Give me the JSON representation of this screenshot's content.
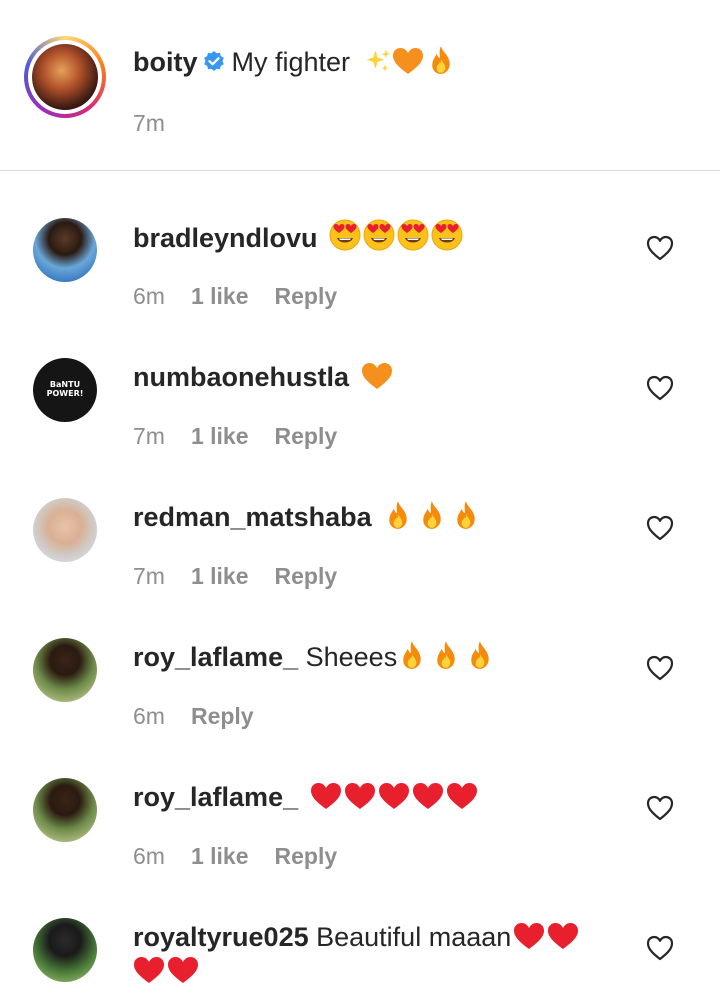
{
  "caption": {
    "username": "boity",
    "text": "My fighter",
    "emojis": [
      "sparkles",
      "orange-heart",
      "fire"
    ],
    "time": "7m"
  },
  "comments": [
    {
      "username": "bradleyndlovu",
      "text": "",
      "emojis": [
        "heart-eyes",
        "heart-eyes",
        "heart-eyes",
        "heart-eyes"
      ],
      "time": "6m",
      "likes": "1 like",
      "reply": "Reply"
    },
    {
      "username": "numbaonehustla",
      "avatar_text": "BaNTU POWER!",
      "text": "",
      "emojis": [
        "orange-heart"
      ],
      "time": "7m",
      "likes": "1 like",
      "reply": "Reply"
    },
    {
      "username": "redman_matshaba",
      "text": "",
      "emojis": [
        "fire",
        "fire",
        "fire"
      ],
      "time": "7m",
      "likes": "1 like",
      "reply": "Reply"
    },
    {
      "username": "roy_laflame_",
      "text": "Sheees",
      "emojis": [
        "fire",
        "fire",
        "fire"
      ],
      "time": "6m",
      "likes": "",
      "reply": "Reply"
    },
    {
      "username": "roy_laflame_",
      "text": "",
      "emojis": [
        "red-heart",
        "red-heart",
        "red-heart",
        "red-heart",
        "red-heart"
      ],
      "time": "6m",
      "likes": "1 like",
      "reply": "Reply"
    },
    {
      "username": "royaltyrue025",
      "text": "Beautiful maaan",
      "emojis": [
        "red-heart",
        "red-heart",
        "red-heart",
        "red-heart"
      ],
      "time": "",
      "likes": "",
      "reply": ""
    }
  ],
  "colors": {
    "text": "#262626",
    "meta": "#8e8e8e",
    "divider": "#dbdbdb",
    "verified": "#3897f0",
    "heart": "#e8202e",
    "orange_heart": "#f5901e",
    "fire_outer": "#f58b0e",
    "fire_inner": "#fcd33a"
  }
}
